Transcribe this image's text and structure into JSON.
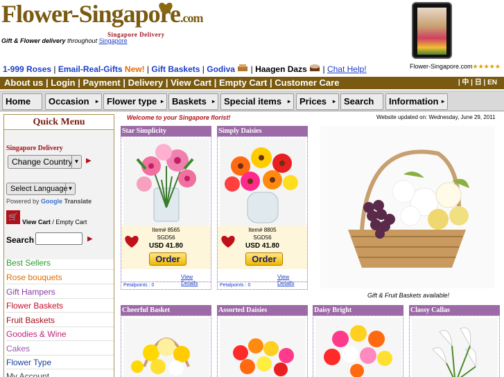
{
  "header": {
    "logo_main": "Flower-Singapore",
    "logo_suffix": ".com",
    "logo_sub": "Singapore Delivery",
    "tagline_bold": "Gift & Flower delivery",
    "tagline_mid": " throughout ",
    "tagline_link": "Singapore"
  },
  "toplinks": {
    "roses": "1-999 Roses",
    "sep": "|",
    "email_gifts": "Email-Real-Gifts",
    "new_badge": "New!",
    "gift_baskets": "Gift Baskets",
    "godiva": "Godiva",
    "haagen": "Haagen Dazs",
    "chat": "Chat Help!",
    "site_name": "Flower-Singapore.com",
    "stars": "★★★★★",
    "colors": {
      "link": "#1a3ec8",
      "new": "#e86a00"
    }
  },
  "nav1": {
    "items": [
      "About us",
      "Login",
      "Payment",
      "Delivery",
      "View Cart",
      "Empty Cart",
      "Customer Care"
    ],
    "sep": "|",
    "lang": "| 中 | 日 | EN",
    "bg": "#7a5a10"
  },
  "nav2": {
    "tabs": [
      {
        "label": "Home",
        "arrow": ""
      },
      {
        "label": "Occasion",
        "arrow": "▸"
      },
      {
        "label": "Flower type",
        "arrow": "▸"
      },
      {
        "label": "Baskets",
        "arrow": "▸"
      },
      {
        "label": "Special items",
        "arrow": "▸"
      },
      {
        "label": "Prices",
        "arrow": "▸"
      },
      {
        "label": "Search",
        "arrow": ""
      },
      {
        "label": "Information",
        "arrow": "▸"
      }
    ]
  },
  "sidebar": {
    "title": "Quick Menu",
    "delivery_label": "Singapore Delivery",
    "country_select": "Change Country",
    "language_select": "Select Language",
    "powered_by": "Powered by",
    "google": "Google",
    "translate": "Translate",
    "view_cart": "View Cart",
    "empty_cart": "/ Empty Cart",
    "search_label": "Search",
    "search_value": "",
    "menu": [
      {
        "label": "Best Sellers",
        "color": "#2a9a2a"
      },
      {
        "label": "Rose bouquets",
        "color": "#e86a00"
      },
      {
        "label": "Gift Hampers",
        "color": "#8a3aa6"
      },
      {
        "label": "Flower Baskets",
        "color": "#c0102a"
      },
      {
        "label": "Fruit Baskets",
        "color": "#a0101a"
      },
      {
        "label": "Goodies & Wine",
        "color": "#c0207a"
      },
      {
        "label": "Cakes",
        "color": "#9a5ab0"
      },
      {
        "label": "Flower Type",
        "color": "#1a3e9a"
      },
      {
        "label": "My Account",
        "color": "#444"
      }
    ]
  },
  "main": {
    "welcome": "Welcome to your Singapore florist!",
    "updated": "Website updated on: Wednesday, June 29, 2011",
    "featured_caption": "Gift & Fruit Baskets available!",
    "products_top": [
      {
        "title": "Star Simplicity",
        "item": "Item# 8565",
        "sgd": "SGD56",
        "usd": "USD 41.80",
        "order": "Order",
        "details": "View Details",
        "petal": "Petalpoints : 0"
      },
      {
        "title": "Simply Daisies",
        "item": "Item# 8805",
        "sgd": "SGD56",
        "usd": "USD 41.80",
        "order": "Order",
        "details": "View Details",
        "petal": "Petalpoints : 0"
      }
    ],
    "products_bottom": [
      {
        "title": "Cheerful Basket"
      },
      {
        "title": "Assorted Daisies"
      },
      {
        "title": "Daisy Bright"
      },
      {
        "title": "Classy Callas"
      }
    ]
  }
}
